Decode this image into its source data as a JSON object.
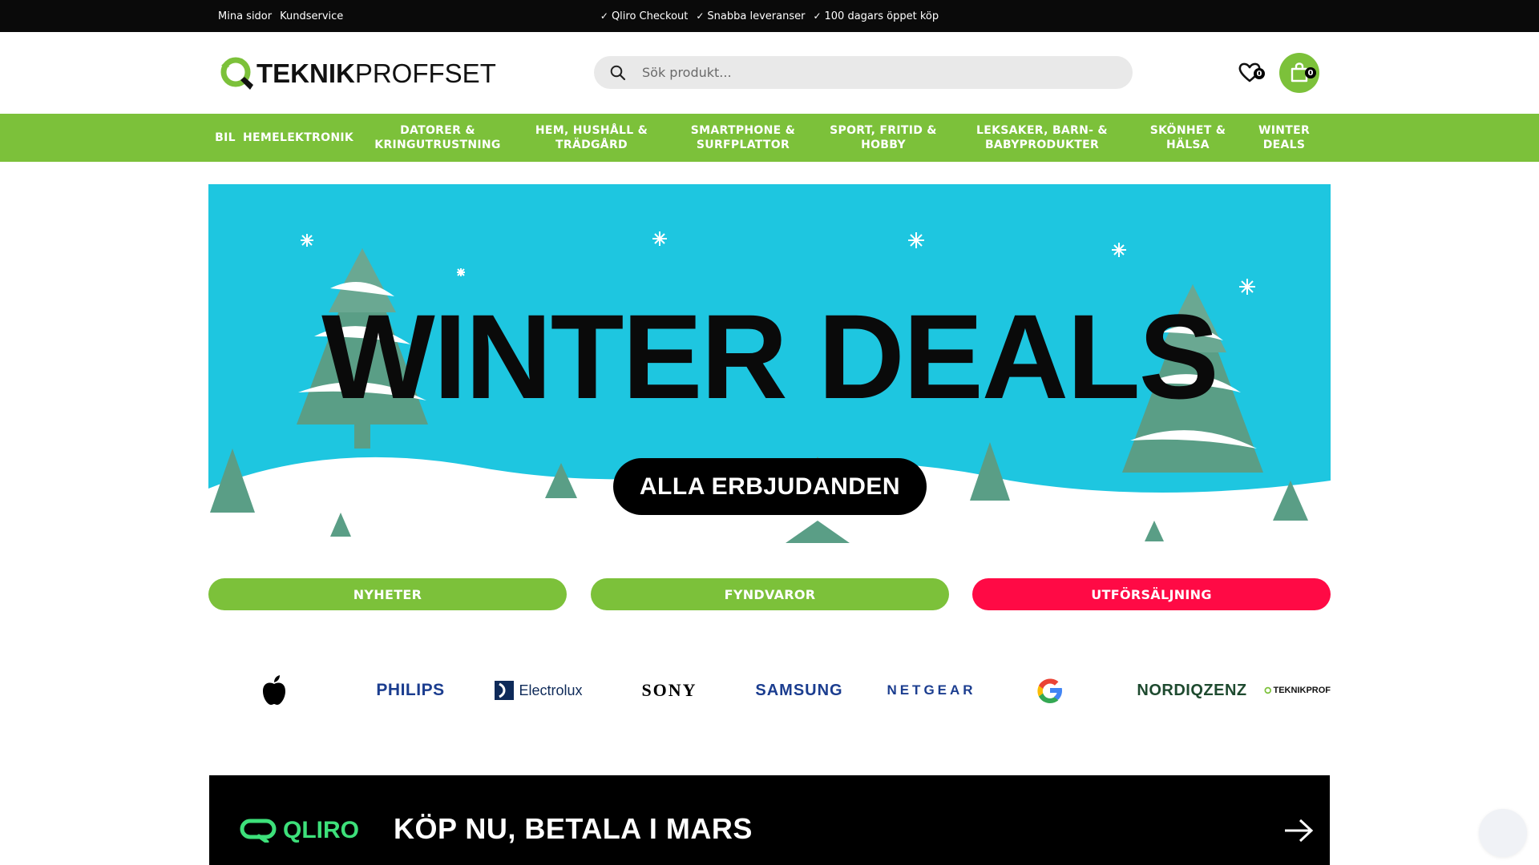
{
  "topbar": {
    "links": [
      "Mina sidor",
      "Kundservice"
    ],
    "usps": [
      "Qliro Checkout",
      "Snabba leveranser",
      "100 dagars öppet köp"
    ]
  },
  "header": {
    "logo_bold": "TEKNIK",
    "logo_light": "PROFFSET",
    "search_placeholder": "Sök produkt...",
    "wishlist_count": "0",
    "cart_count": "0"
  },
  "nav": {
    "items": [
      {
        "line1": "BIL",
        "line2": ""
      },
      {
        "line1": "HEMELEKTRONIK",
        "line2": ""
      },
      {
        "line1": "DATORER &",
        "line2": "KRINGUTRUSTNING"
      },
      {
        "line1": "HEM, HUSHÅLL &",
        "line2": "TRÄDGÅRD"
      },
      {
        "line1": "SMARTPHONE &",
        "line2": "SURFPLATTOR"
      },
      {
        "line1": "SPORT, FRITID &",
        "line2": "HOBBY"
      },
      {
        "line1": "LEKSAKER, BARN- &",
        "line2": "BABYPRODUKTER"
      },
      {
        "line1": "SKÖNHET &",
        "line2": "HÄLSA"
      },
      {
        "line1": "WINTER",
        "line2": "DEALS"
      }
    ]
  },
  "hero": {
    "title": "WINTER DEALS",
    "cta": "ALLA ERBJUDANDEN"
  },
  "pills": {
    "news": "NYHETER",
    "bargains": "FYNDVAROR",
    "sale": "UTFÖRSÄLJNING"
  },
  "brands": {
    "philips": "PHILIPS",
    "electrolux": "Electrolux",
    "sony": "SONY",
    "samsung": "SAMSUNG",
    "netgear": "NETGEAR",
    "nordiqzenz": "NORDIQZENZ",
    "teknikprof": "TEKNIKPROF"
  },
  "qliro": {
    "logo": "QLIRO",
    "text": "KÖP NU, BETALA I MARS"
  },
  "colors": {
    "accent_green": "#7cc13a",
    "sale_red": "#ff0a45",
    "hero_blue": "#1ec6e0",
    "qliro_green": "#3de07a"
  },
  "icons": [
    "search-icon",
    "heart-icon",
    "cart-icon",
    "check-icon",
    "apple-logo-icon",
    "google-logo-icon",
    "arrow-right-icon"
  ]
}
